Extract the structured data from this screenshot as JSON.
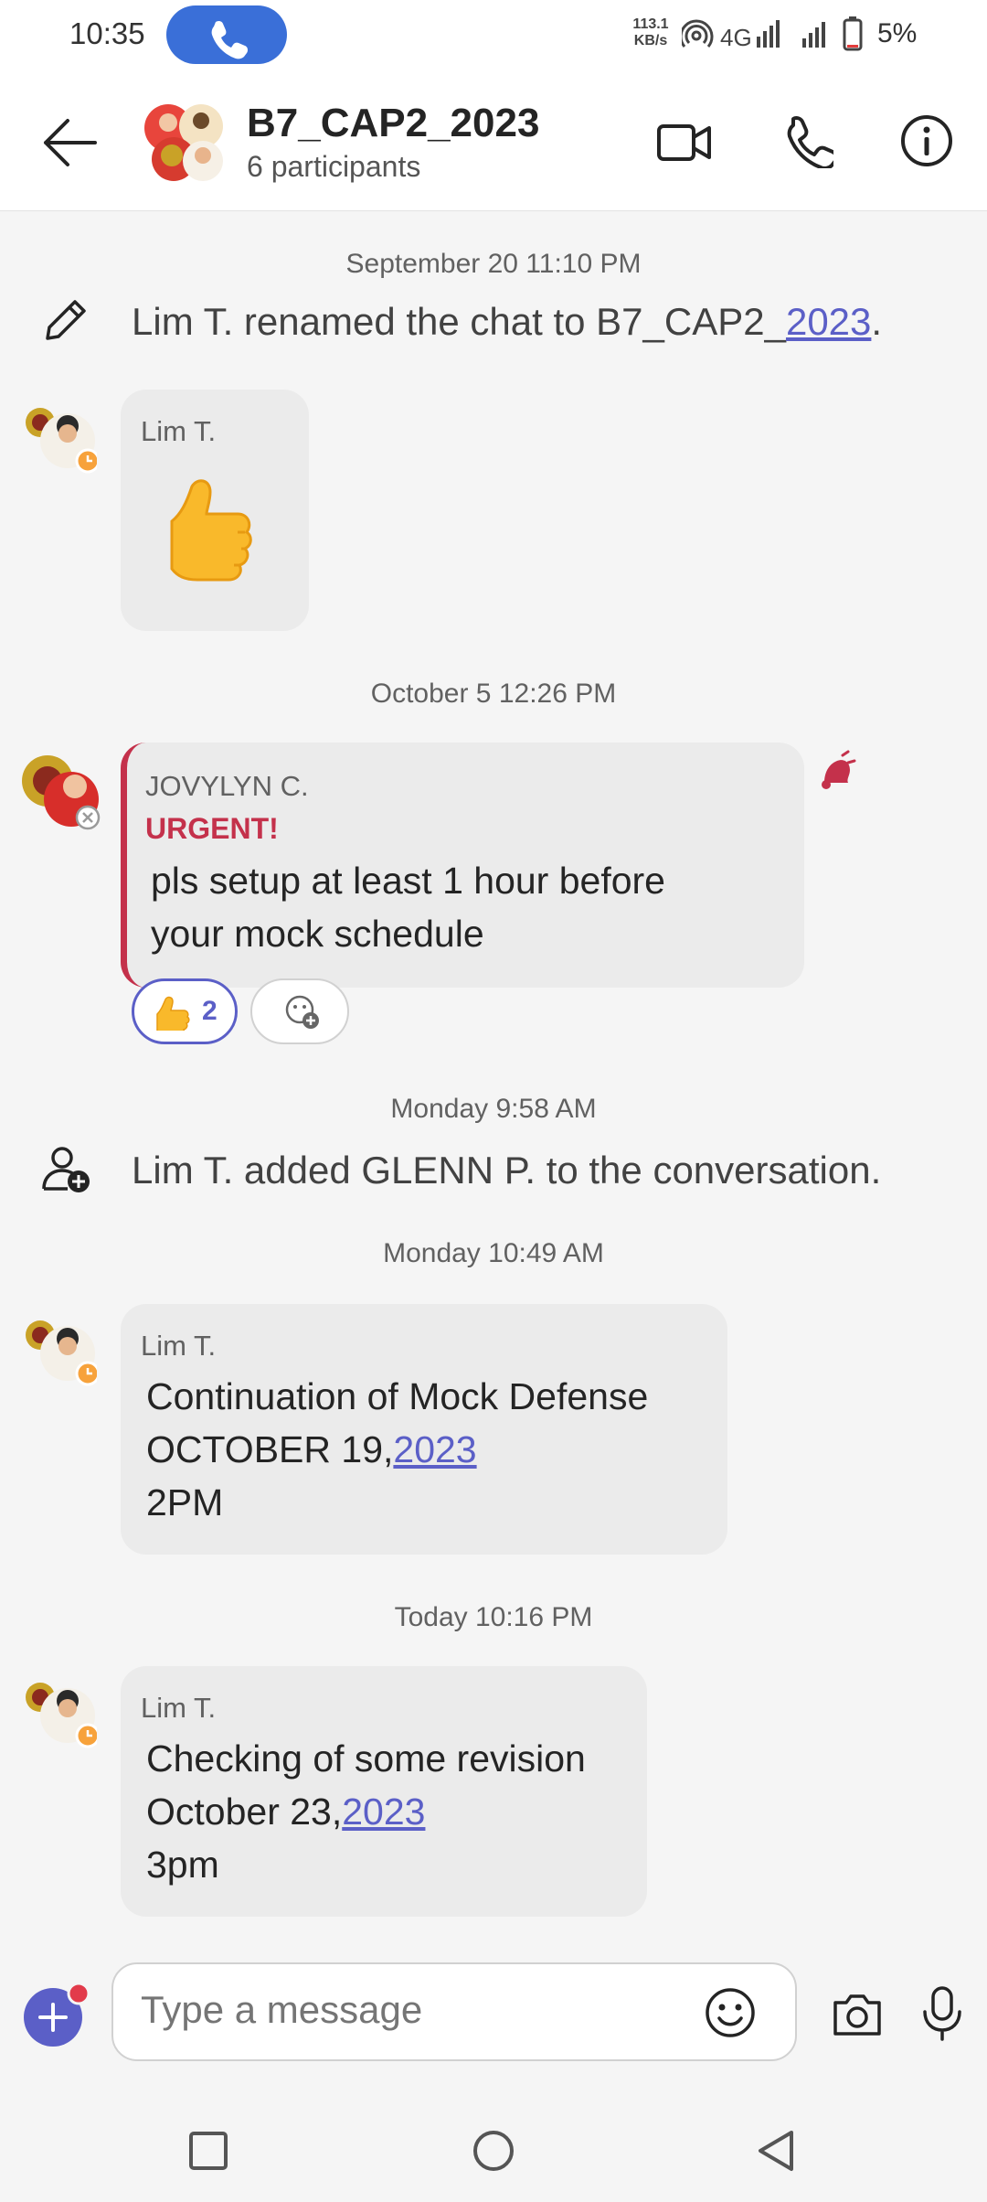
{
  "status_bar": {
    "time": "10:35",
    "kbs_top": "113.1",
    "kbs_bottom": "KB/s",
    "network": "4G",
    "battery": "5%"
  },
  "header": {
    "title": "B7_CAP2_2023",
    "subtitle": "6 participants"
  },
  "messages": {
    "ts1": "September 20 11:10 PM",
    "rename_prefix": "Lim T. renamed the chat to B7_CAP2_",
    "rename_link": "2023",
    "rename_suffix": ".",
    "thumb_sender": "Lim T.",
    "ts2": "October 5 12:26 PM",
    "urgent_sender": "JOVYLYN C.",
    "urgent_label": "URGENT!",
    "urgent_line1": "pls setup at least 1 hour before",
    "urgent_line2": "your mock schedule",
    "reaction_count": "2",
    "ts3": "Monday 9:58 AM",
    "added_text": "Lim T. added GLENN P. to the conversation.",
    "ts4": "Monday 10:49 AM",
    "m4_sender": "Lim T.",
    "m4_line1": "Continuation of Mock Defense",
    "m4_line2_prefix": "OCTOBER 19,",
    "m4_line2_link": "2023",
    "m4_line3": "2PM",
    "ts5": "Today 10:16 PM",
    "m5_sender": "Lim T.",
    "m5_line1": "Checking of some revision",
    "m5_line2_prefix": "October 23,",
    "m5_line2_link": "2023",
    "m5_line3": "3pm"
  },
  "composer": {
    "placeholder": "Type a message"
  },
  "colors": {
    "accent": "#5b5fc7",
    "urgent": "#c4314b",
    "call_pill": "#3a6fd8"
  }
}
